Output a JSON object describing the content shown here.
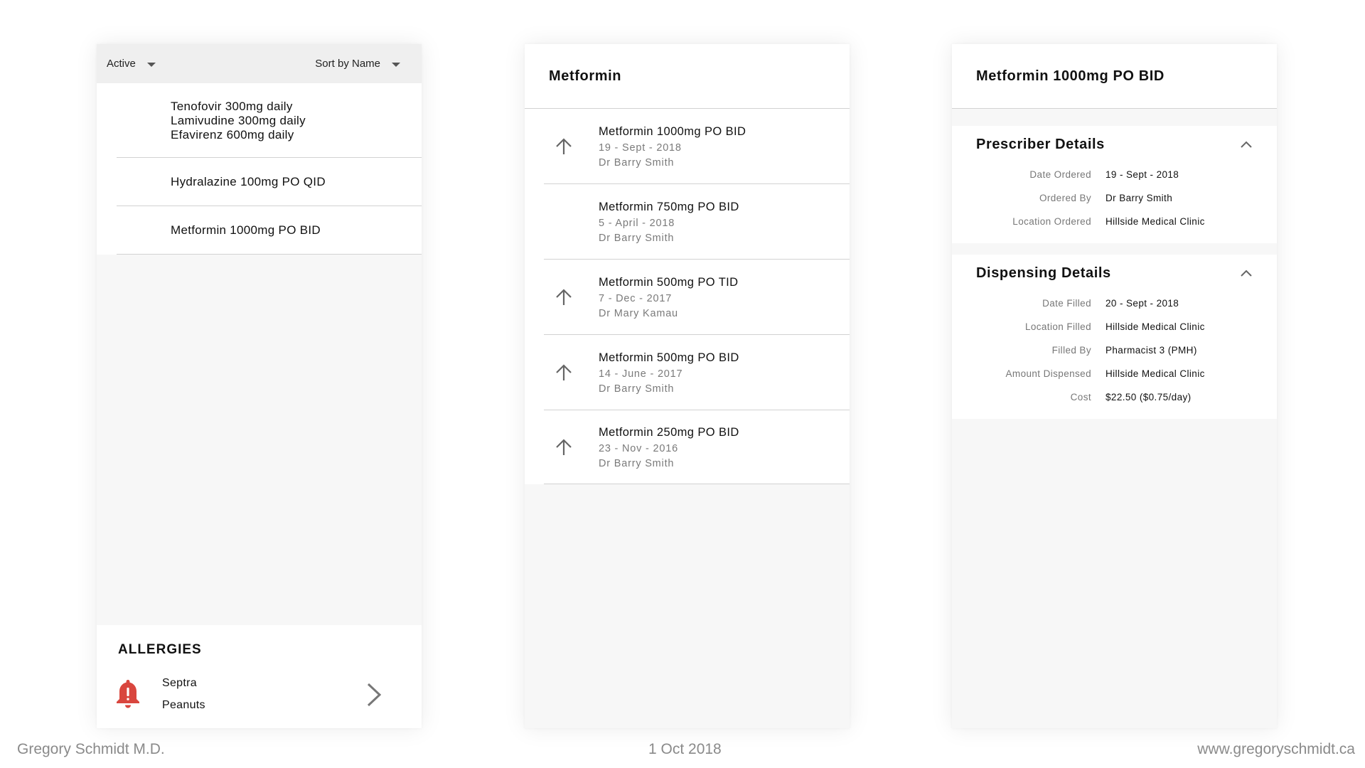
{
  "list_panel": {
    "filter_label": "Active",
    "sort_label": "Sort by Name",
    "medications": [
      {
        "lines": [
          "Tenofovir 300mg daily",
          "Lamivudine 300mg daily",
          "Efavirenz 600mg daily"
        ]
      },
      {
        "lines": [
          "Hydralazine 100mg PO QID"
        ]
      },
      {
        "lines": [
          "Metformin 1000mg PO BID"
        ]
      }
    ],
    "allergies": {
      "title": "ALLERGIES",
      "items": [
        "Septra",
        "Peanuts"
      ],
      "icon": "bell-alert-icon",
      "icon_color": "#d9463e"
    }
  },
  "history_panel": {
    "title": "Metformin",
    "items": [
      {
        "name": "Metformin 1000mg PO BID",
        "date": "19 - Sept - 2018",
        "doctor": "Dr Barry Smith",
        "arrow": true
      },
      {
        "name": "Metformin 750mg PO BID",
        "date": "5 - April - 2018",
        "doctor": "Dr Barry Smith",
        "arrow": false
      },
      {
        "name": "Metformin 500mg PO TID",
        "date": "7 - Dec - 2017",
        "doctor": "Dr Mary Kamau",
        "arrow": true
      },
      {
        "name": "Metformin 500mg PO BID",
        "date": "14 - June - 2017",
        "doctor": "Dr Barry Smith",
        "arrow": true
      },
      {
        "name": "Metformin 250mg PO BID",
        "date": "23 - Nov - 2016",
        "doctor": "Dr Barry Smith",
        "arrow": true
      }
    ]
  },
  "detail_panel": {
    "title": "Metformin 1000mg PO BID",
    "prescriber": {
      "title": "Prescriber Details",
      "fields": [
        {
          "label": "Date Ordered",
          "value": "19 - Sept - 2018"
        },
        {
          "label": "Ordered By",
          "value": "Dr Barry Smith"
        },
        {
          "label": "Location Ordered",
          "value": "Hillside Medical Clinic"
        }
      ]
    },
    "dispensing": {
      "title": "Dispensing Details",
      "fields": [
        {
          "label": "Date Filled",
          "value": "20 - Sept - 2018"
        },
        {
          "label": "Location Filled",
          "value": "Hillside Medical Clinic"
        },
        {
          "label": "Filled By",
          "value": "Pharmacist 3 (PMH)"
        },
        {
          "label": "Amount Dispensed",
          "value": "Hillside Medical Clinic"
        },
        {
          "label": "Cost",
          "value": "$22.50 ($0.75/day)"
        }
      ]
    }
  },
  "footer": {
    "author": "Gregory Schmidt M.D.",
    "date": "1 Oct 2018",
    "website": "www.gregoryschmidt.ca"
  }
}
